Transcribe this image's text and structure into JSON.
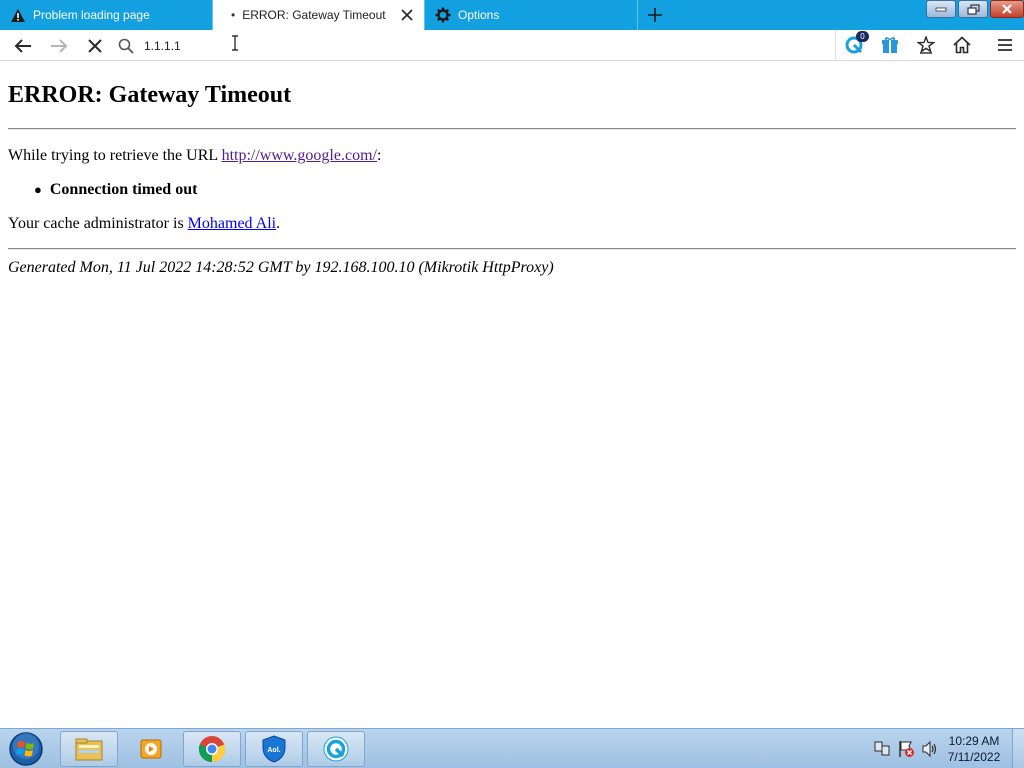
{
  "browser": {
    "tabs": [
      {
        "label": "Problem loading page",
        "icon": "warning-icon",
        "active": false
      },
      {
        "label": "ERROR: Gateway Timeout",
        "icon": "loading-dot",
        "active": true
      },
      {
        "label": "Options",
        "icon": "gear-icon",
        "active": false
      }
    ],
    "url": "1.1.1.1",
    "badge_count": "0",
    "accent_color": "#12a0e0"
  },
  "page": {
    "heading": "ERROR: Gateway Timeout",
    "retrieve_prefix": "While trying to retrieve the URL ",
    "retrieve_url": "http://www.google.com/",
    "retrieve_suffix": ":",
    "bullet_item": "Connection timed out",
    "admin_prefix": "Your cache administrator is ",
    "admin_name": "Mohamed Ali",
    "admin_suffix": ".",
    "footer": "Generated Mon, 11 Jul 2022 14:28:52 GMT by 192.168.100.10 (Mikrotik HttpProxy)"
  },
  "taskbar": {
    "apps": [
      "file-explorer-icon",
      "media-player-icon",
      "chrome-icon",
      "aol-shield-icon",
      "refresh-app-icon"
    ],
    "time": "10:29 AM",
    "date": "7/11/2022"
  }
}
